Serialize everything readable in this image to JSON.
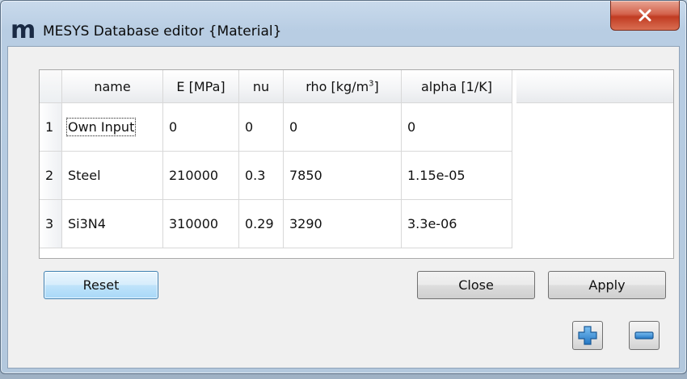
{
  "window": {
    "logo_glyph": "m",
    "title": "MESYS Database editor {Material}"
  },
  "table": {
    "headers": {
      "name": "name",
      "e_mpa": "E [MPa]",
      "nu": "nu",
      "rho_prefix": "rho [kg/m",
      "rho_sup": "3",
      "rho_suffix": "]",
      "alpha": "alpha [1/K]"
    },
    "rows": [
      {
        "index": "1",
        "name": "Own Input",
        "e_mpa": "0",
        "nu": "0",
        "rho": "0",
        "alpha": "0"
      },
      {
        "index": "2",
        "name": "Steel",
        "e_mpa": "210000",
        "nu": "0.3",
        "rho": "7850",
        "alpha": "1.15e-05"
      },
      {
        "index": "3",
        "name": "Si3N4",
        "e_mpa": "310000",
        "nu": "0.29",
        "rho": "3290",
        "alpha": "3.3e-06"
      }
    ]
  },
  "buttons": {
    "reset": "Reset",
    "close": "Close",
    "apply": "Apply"
  },
  "icons": {
    "window_close": "close-x-icon",
    "add": "plus-icon",
    "remove": "minus-icon"
  },
  "colors": {
    "icon_fill": "#3a8fd8",
    "reset_border": "#3c7fb1"
  }
}
